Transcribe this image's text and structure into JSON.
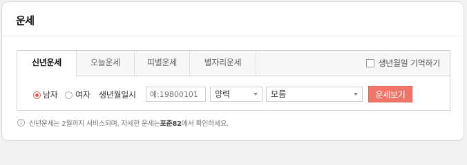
{
  "card": {
    "title": "운세"
  },
  "tabs": [
    {
      "label": "신년운세",
      "active": true
    },
    {
      "label": "오늘운세",
      "active": false
    },
    {
      "label": "띠별운세",
      "active": false
    },
    {
      "label": "별자리운세",
      "active": false
    }
  ],
  "remember": {
    "label": "생년월일 기억하기",
    "checked": false
  },
  "form": {
    "gender_male": "남자",
    "gender_female": "여자",
    "gender_selected": "남자",
    "birth_label": "생년월일시",
    "birth_placeholder": "예:19800101",
    "calendar_select": "양력",
    "time_select": "모름",
    "submit_label": "운세보기"
  },
  "info": {
    "icon": "info-icon",
    "text_before": "신년운세는 2월까지 서비스되며, 자세한 운세는 ",
    "highlight": "포춘82",
    "text_after": "에서 확인하세요."
  },
  "colors": {
    "accent": "#f1766a",
    "radio": "#e65a4a"
  }
}
